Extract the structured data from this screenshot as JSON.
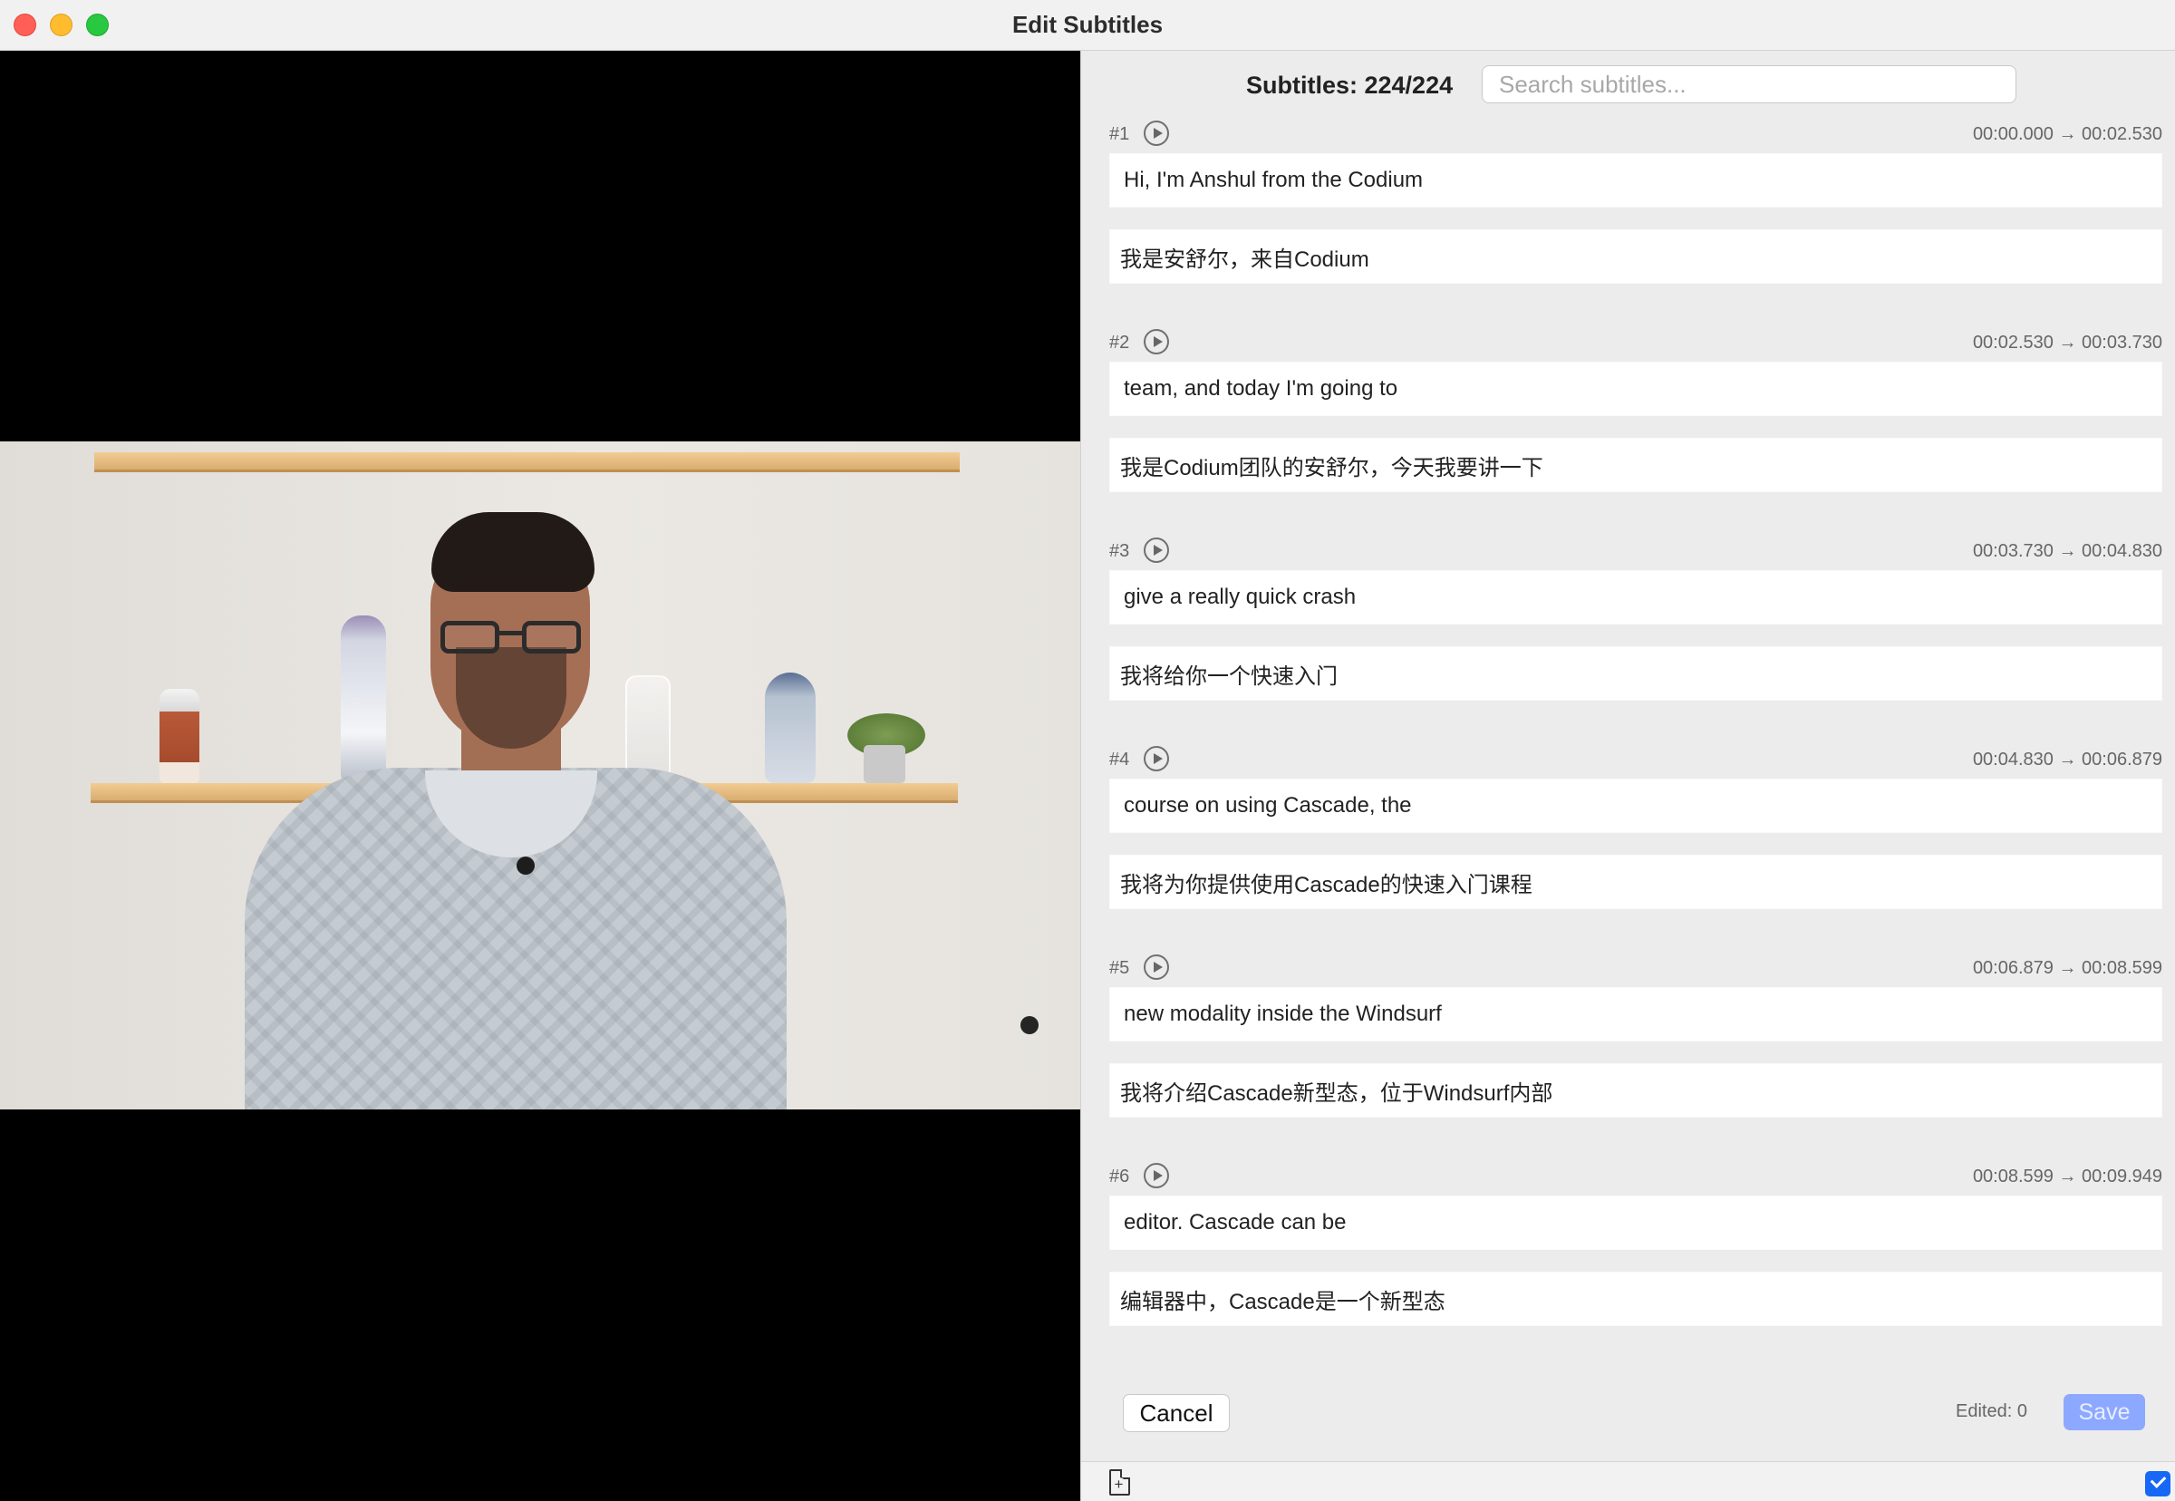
{
  "window": {
    "title": "Edit Subtitles"
  },
  "editor": {
    "subtitle_count": "Subtitles: 224/224",
    "search_placeholder": "Search subtitles...",
    "entries": [
      {
        "number": "#1",
        "time": "00:00.000 → 00:02.530",
        "original": "Hi, I'm Anshul from the Codium",
        "translation": "我是安舒尔，来自Codium"
      },
      {
        "number": "#2",
        "time": "00:02.530 → 00:03.730",
        "original": "team, and today I'm going to",
        "translation": "我是Codium团队的安舒尔，今天我要讲一下"
      },
      {
        "number": "#3",
        "time": "00:03.730 → 00:04.830",
        "original": "give a really quick crash",
        "translation": "我将给你一个快速入门"
      },
      {
        "number": "#4",
        "time": "00:04.830 → 00:06.879",
        "original": "course on using Cascade, the",
        "translation": "我将为你提供使用Cascade的快速入门课程"
      },
      {
        "number": "#5",
        "time": "00:06.879 → 00:08.599",
        "original": "new modality inside the Windsurf",
        "translation": "我将介绍Cascade新型态，位于Windsurf内部"
      },
      {
        "number": "#6",
        "time": "00:08.599 → 00:09.949",
        "original": "editor. Cascade can be",
        "translation": "编辑器中，Cascade是一个新型态"
      }
    ],
    "footer": {
      "cancel_label": "Cancel",
      "edited_label": "Edited: 0",
      "save_label": "Save"
    }
  },
  "icons": {
    "play": "play-icon",
    "document_add": "document-add-icon",
    "checkbox": "checkmark-icon"
  },
  "colors": {
    "save_disabled": "#8da8ff",
    "checkbox_blue": "#1768f5",
    "close": "#ff5f57",
    "minimize": "#febc2e",
    "zoom": "#28c840"
  }
}
